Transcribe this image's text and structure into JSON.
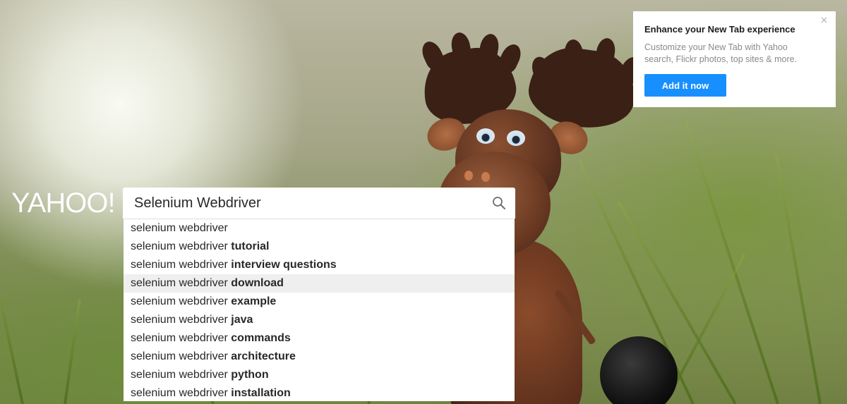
{
  "logo": {
    "text": "YAHOO!"
  },
  "search": {
    "value": "Selenium Webdriver",
    "placeholder": ""
  },
  "suggestions": [
    {
      "base": "selenium webdriver",
      "suffix": ""
    },
    {
      "base": "selenium webdriver ",
      "suffix": "tutorial"
    },
    {
      "base": "selenium webdriver ",
      "suffix": "interview questions"
    },
    {
      "base": "selenium webdriver ",
      "suffix": "download",
      "active": true
    },
    {
      "base": "selenium webdriver ",
      "suffix": "example"
    },
    {
      "base": "selenium webdriver ",
      "suffix": "java"
    },
    {
      "base": "selenium webdriver ",
      "suffix": "commands"
    },
    {
      "base": "selenium webdriver ",
      "suffix": "architecture"
    },
    {
      "base": "selenium webdriver ",
      "suffix": "python"
    },
    {
      "base": "selenium webdriver ",
      "suffix": "installation"
    }
  ],
  "promo": {
    "title": "Enhance your New Tab experience",
    "description": "Customize your New Tab with Yahoo search, Flickr photos, top sites & more.",
    "button_label": "Add it now",
    "close_icon": "close-icon"
  },
  "colors": {
    "accent": "#188fff",
    "suggestion_highlight": "#efefef"
  }
}
